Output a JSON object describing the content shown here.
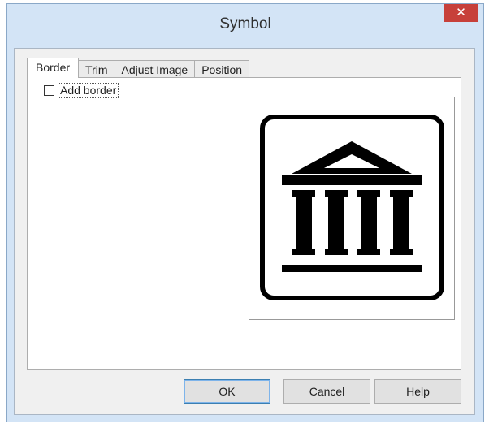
{
  "window": {
    "title": "Symbol",
    "close_label": "✕"
  },
  "tabs": [
    {
      "label": "Border",
      "active": true
    },
    {
      "label": "Trim",
      "active": false
    },
    {
      "label": "Adjust Image",
      "active": false
    },
    {
      "label": "Position",
      "active": false
    }
  ],
  "border_tab": {
    "add_border_label": "Add border",
    "add_border_checked": false,
    "preview_symbol": "museum-building-icon"
  },
  "buttons": {
    "ok": "OK",
    "cancel": "Cancel",
    "help": "Help"
  },
  "colors": {
    "window_frame": "#d3e4f6",
    "close_button": "#c7403a",
    "dialog_background": "#f0f0f0",
    "symbol": "#000000"
  }
}
